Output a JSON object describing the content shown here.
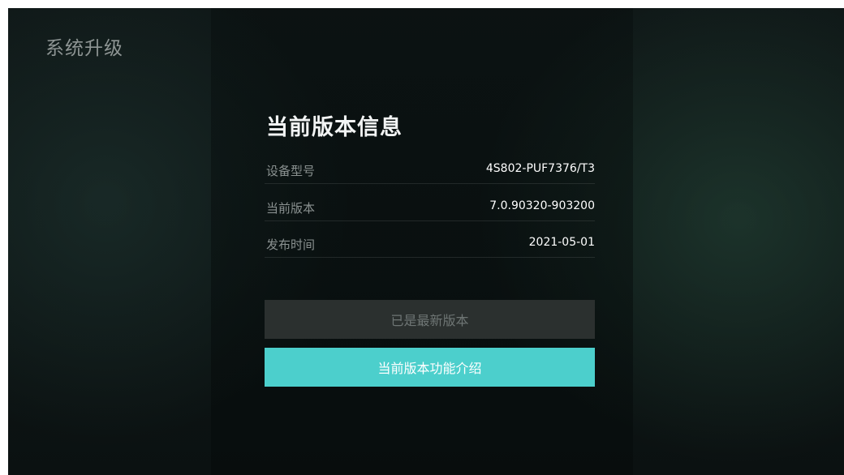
{
  "header": {
    "title": "系统升级"
  },
  "version_info": {
    "title": "当前版本信息",
    "rows": [
      {
        "label": "设备型号",
        "value": "4S802-PUF7376/T3"
      },
      {
        "label": "当前版本",
        "value": "7.0.90320-903200"
      },
      {
        "label": "发布时间",
        "value": "2021-05-01"
      }
    ]
  },
  "buttons": {
    "latest_label": "已是最新版本",
    "intro_label": "当前版本功能介绍"
  },
  "colors": {
    "accent": "#4ccfcc",
    "background": "#0f1717",
    "disabled_button": "#2b302f"
  }
}
